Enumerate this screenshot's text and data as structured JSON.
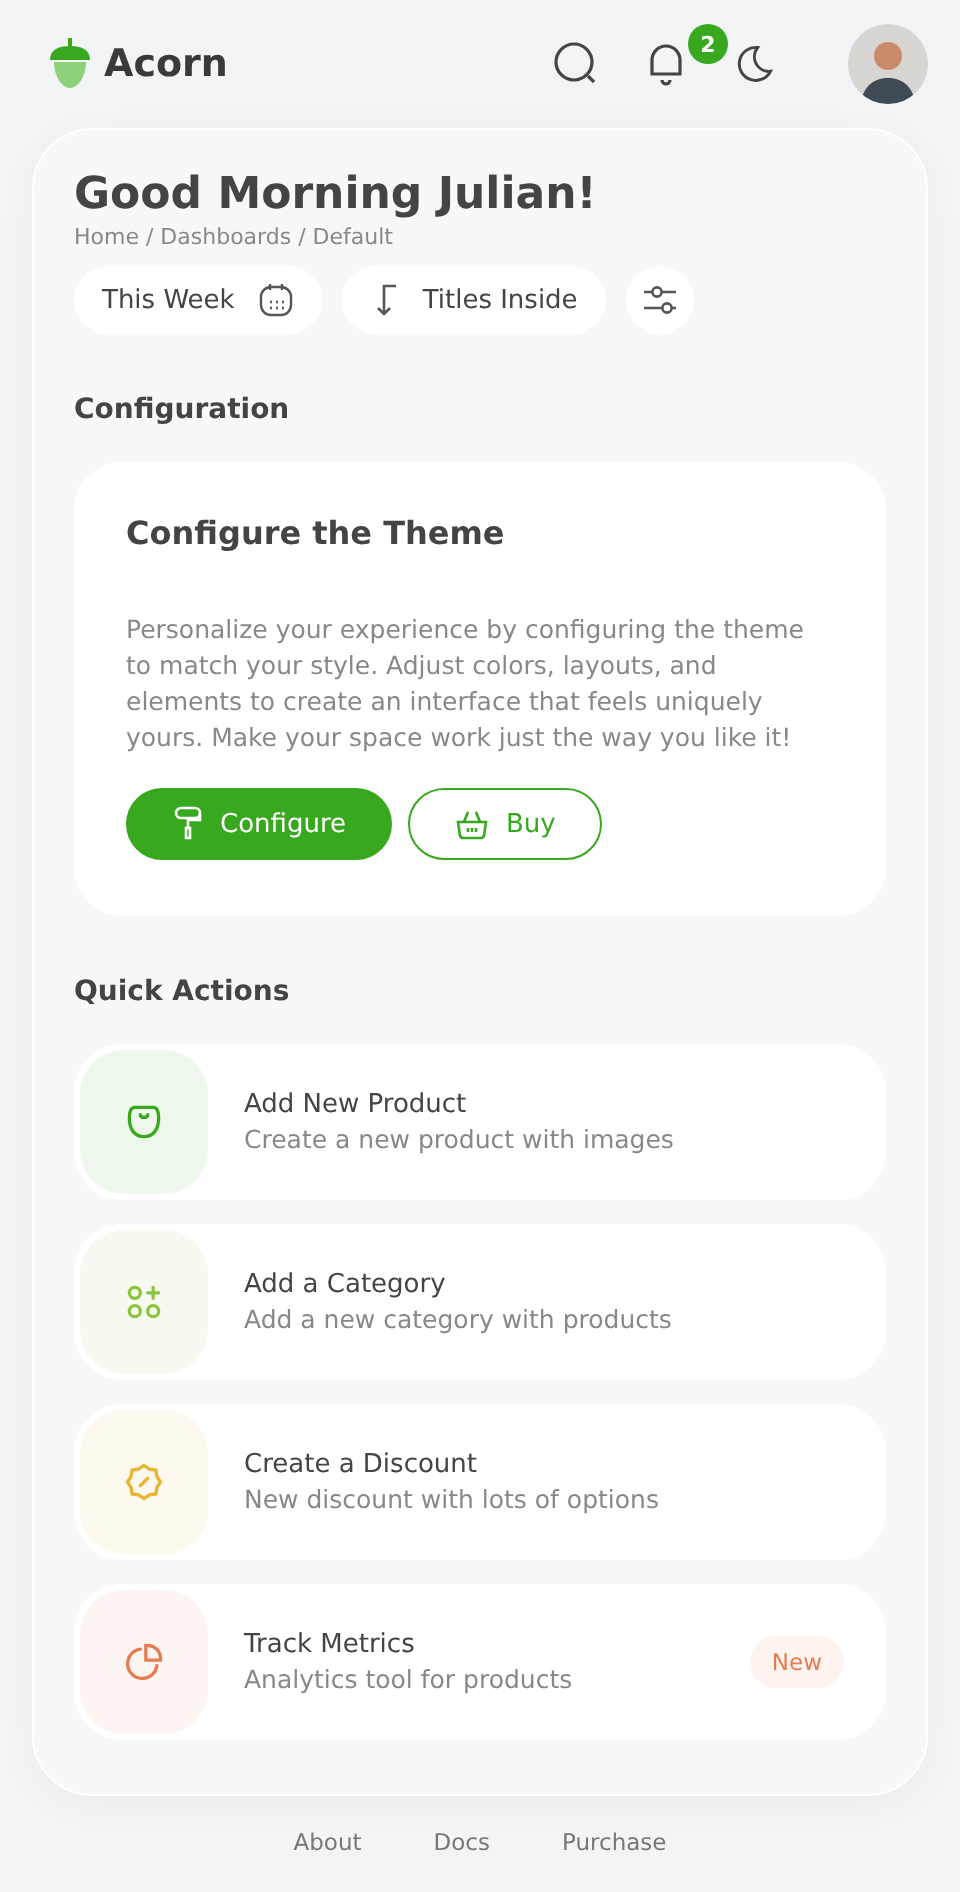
{
  "header": {
    "logo": "Acorn",
    "notifications": "2"
  },
  "page": {
    "title": "Good Morning Julian!",
    "breadcrumb": "Home / Dashboards / Default"
  },
  "toolbar": {
    "period": "This Week",
    "layout": "Titles Inside"
  },
  "configuration": {
    "heading": "Configuration",
    "title": "Configure the Theme",
    "text": "Personalize your experience by configuring the theme to match your style. Adjust colors, layouts, and elements to create an interface that feels uniquely yours. Make your space work just the way you like it!",
    "buttons": [
      {
        "label": "Configure",
        "kind": "primary"
      },
      {
        "label": "Buy",
        "kind": "outline"
      }
    ]
  },
  "quick_actions": {
    "heading": "Quick Actions",
    "items": [
      {
        "kind": "bag",
        "title": "Add New Product",
        "subtitle": "Create a new product with images",
        "color": "#38a81e"
      },
      {
        "kind": "grid",
        "title": "Add a Category",
        "subtitle": "Add a new category with products",
        "color": "#8cc43e"
      },
      {
        "kind": "discount",
        "title": "Create a Discount",
        "subtitle": "New discount with lots of options",
        "color": "#e8b530"
      },
      {
        "kind": "chart",
        "title": "Track Metrics",
        "subtitle": "Analytics tool for products",
        "color": "#e67d52",
        "badge": "New"
      }
    ]
  },
  "footer": [
    "About",
    "Docs",
    "Purchase"
  ]
}
